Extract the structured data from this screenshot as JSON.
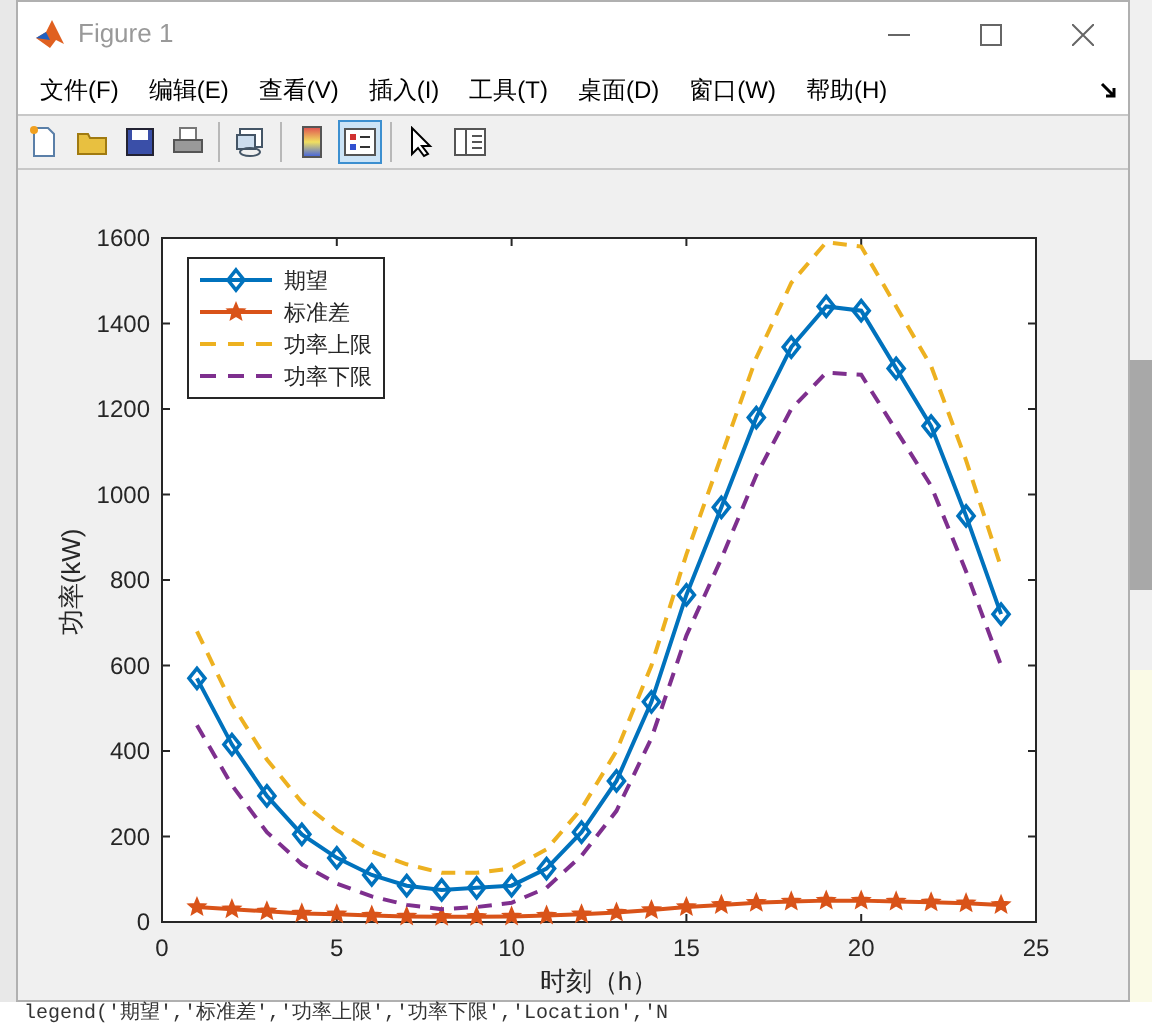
{
  "window": {
    "title": "Figure 1"
  },
  "menu": [
    "文件(F)",
    "编辑(E)",
    "查看(V)",
    "插入(I)",
    "工具(T)",
    "桌面(D)",
    "窗口(W)",
    "帮助(H)"
  ],
  "toolbar": [
    {
      "kind": "new",
      "selected": false
    },
    {
      "kind": "open",
      "selected": false
    },
    {
      "kind": "save",
      "selected": false
    },
    {
      "kind": "print",
      "selected": false
    },
    {
      "kind": "sep"
    },
    {
      "kind": "link",
      "selected": false
    },
    {
      "kind": "sep"
    },
    {
      "kind": "colorbar",
      "selected": false
    },
    {
      "kind": "legend",
      "selected": true
    },
    {
      "kind": "sep"
    },
    {
      "kind": "pointer",
      "selected": false
    },
    {
      "kind": "inspector",
      "selected": false
    }
  ],
  "chart_data": {
    "type": "line",
    "legend": true,
    "xlabel": "时刻（h）",
    "ylabel": "功率(kW)",
    "x": [
      1,
      2,
      3,
      4,
      5,
      6,
      7,
      8,
      9,
      10,
      11,
      12,
      13,
      14,
      15,
      16,
      17,
      18,
      19,
      20,
      21,
      22,
      23,
      24
    ],
    "xlim": [
      0,
      25
    ],
    "ylim": [
      0,
      1600
    ],
    "xticks": [
      0,
      5,
      10,
      15,
      20,
      25
    ],
    "yticks": [
      0,
      200,
      400,
      600,
      800,
      1000,
      1200,
      1400,
      1600
    ],
    "series": [
      {
        "name": "期望",
        "color": "#0072bd",
        "marker": "diamond",
        "line_style": "solid",
        "values": [
          570,
          415,
          295,
          205,
          150,
          110,
          85,
          75,
          80,
          85,
          125,
          210,
          330,
          515,
          765,
          970,
          1180,
          1345,
          1440,
          1430,
          1295,
          1160,
          950,
          720
        ]
      },
      {
        "name": "标准差",
        "color": "#d95319",
        "marker": "star",
        "line_style": "solid",
        "values": [
          35,
          30,
          25,
          20,
          18,
          15,
          13,
          12,
          12,
          13,
          15,
          18,
          22,
          28,
          35,
          40,
          45,
          48,
          50,
          50,
          48,
          46,
          44,
          40
        ]
      },
      {
        "name": "功率上限",
        "color": "#edb120",
        "marker": "none",
        "line_style": "dashed",
        "values": [
          680,
          510,
          380,
          280,
          215,
          165,
          135,
          115,
          115,
          125,
          170,
          265,
          400,
          600,
          860,
          1090,
          1320,
          1495,
          1590,
          1580,
          1440,
          1300,
          1080,
          830
        ]
      },
      {
        "name": "功率下限",
        "color": "#7e2f8e",
        "marker": "none",
        "line_style": "dashed",
        "values": [
          460,
          320,
          210,
          135,
          90,
          60,
          40,
          30,
          35,
          45,
          80,
          155,
          260,
          430,
          670,
          850,
          1045,
          1200,
          1285,
          1280,
          1150,
          1020,
          820,
          600
        ]
      }
    ]
  },
  "background_code": "legend('期望','标准差','功率上限','功率下限','Location','N"
}
